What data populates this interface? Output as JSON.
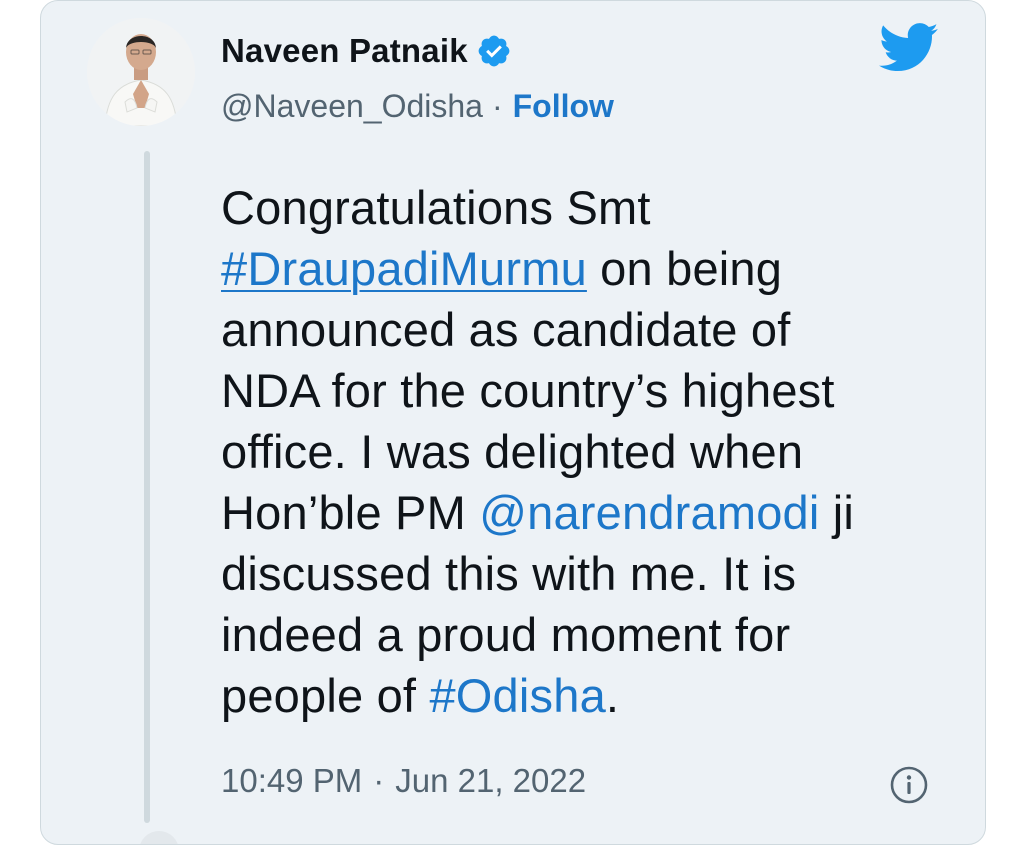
{
  "author": {
    "name": "Naveen Patnaik",
    "handle": "@Naveen_Odisha",
    "separator": "·",
    "follow_label": "Follow",
    "verified_icon": "verified-badge-icon"
  },
  "brand": {
    "icon": "twitter-bird-icon",
    "color": "#1d9bf0"
  },
  "tweet": {
    "lines": [
      {
        "parts": [
          {
            "text": "Congratulations Smt",
            "kind": "text"
          }
        ]
      },
      {
        "parts": [
          {
            "text": "#DraupadiMurmu",
            "kind": "hashtag-underlined"
          },
          {
            "text": " on being",
            "kind": "text"
          }
        ]
      },
      {
        "parts": [
          {
            "text": "announced as candidate of",
            "kind": "text"
          }
        ]
      },
      {
        "parts": [
          {
            "text": "NDA for the country’s highest",
            "kind": "text"
          }
        ]
      },
      {
        "parts": [
          {
            "text": "office. I was delighted when",
            "kind": "text"
          }
        ]
      },
      {
        "parts": [
          {
            "text": "Hon’ble PM ",
            "kind": "text"
          },
          {
            "text": "@narendramodi",
            "kind": "mention"
          },
          {
            "text": " ji",
            "kind": "text"
          }
        ]
      },
      {
        "parts": [
          {
            "text": "discussed this with me. It is",
            "kind": "text"
          }
        ]
      },
      {
        "parts": [
          {
            "text": "indeed a proud moment for",
            "kind": "text"
          }
        ]
      },
      {
        "parts": [
          {
            "text": "people of ",
            "kind": "text"
          },
          {
            "text": "#Odisha",
            "kind": "hashtag"
          },
          {
            "text": ".",
            "kind": "text"
          }
        ]
      }
    ]
  },
  "meta": {
    "time": "10:49 PM",
    "separator": "·",
    "date": "Jun 21, 2022",
    "info_icon": "info-icon"
  },
  "colors": {
    "link": "#1d77c9",
    "text": "#0f1419",
    "muted": "#536471",
    "card_bg": "#edf2f6"
  }
}
